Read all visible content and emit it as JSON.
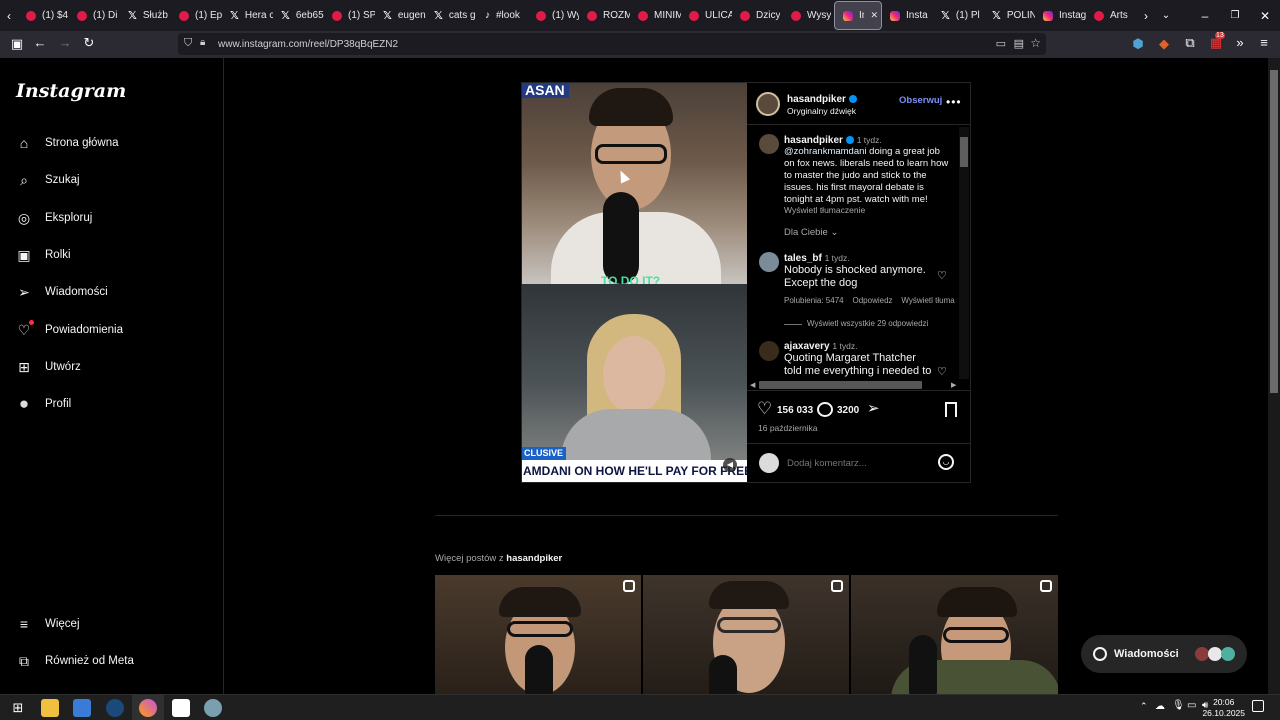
{
  "browser": {
    "tabs": [
      {
        "label": "(1) $4",
        "icon": "youtube-icon",
        "kind": "yt"
      },
      {
        "label": "(1) Di",
        "icon": "youtube-icon",
        "kind": "yt"
      },
      {
        "label": "Służb",
        "icon": "x-icon",
        "kind": "x"
      },
      {
        "label": "(1) Ep",
        "icon": "youtube-icon",
        "kind": "yt"
      },
      {
        "label": "Hera c",
        "icon": "x-icon",
        "kind": "x"
      },
      {
        "label": "6eb65",
        "icon": "x-icon",
        "kind": "x"
      },
      {
        "label": "(1) SP",
        "icon": "youtube-icon",
        "kind": "yt"
      },
      {
        "label": "eugen",
        "icon": "x-icon",
        "kind": "x"
      },
      {
        "label": "cats g",
        "icon": "x-icon",
        "kind": "x"
      },
      {
        "label": "#look",
        "icon": "tiktok-icon",
        "kind": "tt"
      },
      {
        "label": "(1) Wy",
        "icon": "youtube-icon",
        "kind": "yt"
      },
      {
        "label": "ROZM",
        "icon": "youtube-icon",
        "kind": "yt"
      },
      {
        "label": "MINIM",
        "icon": "youtube-icon",
        "kind": "yt"
      },
      {
        "label": "ULICA",
        "icon": "youtube-icon",
        "kind": "yt"
      },
      {
        "label": "Dzicy",
        "icon": "youtube-icon",
        "kind": "yt"
      },
      {
        "label": "Wysy",
        "icon": "youtube-icon",
        "kind": "yt"
      },
      {
        "label": "Ins",
        "icon": "instagram-icon",
        "kind": "ig",
        "active": true
      },
      {
        "label": "Insta",
        "icon": "instagram-icon",
        "kind": "ig"
      },
      {
        "label": "(1) Pl",
        "icon": "x-icon",
        "kind": "x"
      },
      {
        "label": "POLIN",
        "icon": "x-icon",
        "kind": "x"
      },
      {
        "label": "Instag",
        "icon": "instagram-icon",
        "kind": "ig"
      },
      {
        "label": "Arts",
        "icon": "youtube-icon",
        "kind": "yt"
      }
    ],
    "url": "www.instagram.com/reel/DP38qBqEZN2",
    "extension_badge": "13"
  },
  "sidebar": {
    "logo": "Instagram",
    "items": [
      {
        "label": "Strona główna",
        "icon": "home-icon"
      },
      {
        "label": "Szukaj",
        "icon": "search-icon"
      },
      {
        "label": "Eksploruj",
        "icon": "compass-icon"
      },
      {
        "label": "Rolki",
        "icon": "reels-icon"
      },
      {
        "label": "Wiadomości",
        "icon": "send-icon"
      },
      {
        "label": "Powiadomienia",
        "icon": "heart-icon"
      },
      {
        "label": "Utwórz",
        "icon": "plus-square-icon"
      },
      {
        "label": "Profil",
        "icon": "avatar-icon"
      }
    ],
    "bottom_items": [
      {
        "label": "Więcej",
        "icon": "menu-icon"
      },
      {
        "label": "Również od Meta",
        "icon": "meta-icon"
      }
    ]
  },
  "video": {
    "overlay_top": "ASAN",
    "caption_mid": "TO DO IT?",
    "exclusive": "CLUSIVE",
    "chyron": "AMDANI ON HOW HE'LL PAY FOR FREE BUSE"
  },
  "post": {
    "author": "hasandpiker",
    "audio": "Oryginalny dźwięk",
    "follow": "Obserwuj",
    "caption": {
      "author": "hasandpiker",
      "time": "1 tydz.",
      "mention": "@zohrankmamdani",
      "text": " doing a great job on fox news. liberals need to learn how to master the judo and stick to the issues. his first mayoral debate is tonight at 4pm pst. watch with me!",
      "translate": "Wyświetl tłumaczenie"
    },
    "for_you": "Dla Ciebie",
    "comments": [
      {
        "author": "tales_bf",
        "time": "1 tydz.",
        "text": "Nobody is shocked anymore. Except the dog",
        "likes": "Polubienia: 5474",
        "reply": "Odpowiedz",
        "translate": "Wyświetl tłuma"
      },
      {
        "author": "ajaxavery",
        "time": "1 tydz.",
        "text": "Quoting Margaret Thatcher told me everything i needed to"
      }
    ],
    "view_replies": "Wyświetl wszystkie 29 odpowiedzi",
    "likes_count": "156 033",
    "comments_count": "3200",
    "date": "16 października",
    "add_comment_placeholder": "Dodaj komentarz..."
  },
  "more": {
    "prefix": "Więcej postów z ",
    "author": "hasandpiker"
  },
  "messages_pill": {
    "label": "Wiadomości"
  },
  "taskbar": {
    "time": "20:06",
    "date": "26.10.2025"
  },
  "colors": {
    "accent_blue": "#0095f6",
    "follow": "#7d8ff5",
    "background": "#000000"
  }
}
